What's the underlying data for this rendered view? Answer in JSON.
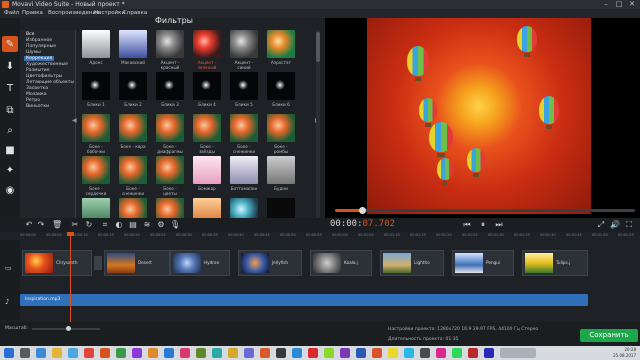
{
  "window": {
    "title": "Movavi Video Suite - Новый проект *",
    "min": "–",
    "max": "□",
    "close": "✕"
  },
  "menu": [
    "Файл",
    "Правка",
    "Воспроизведение",
    "Настройки",
    "Справка"
  ],
  "panel_title": "Фильтры",
  "categories": [
    "Все",
    "Избранное",
    "Популярные",
    "Шумы",
    "Коррекция",
    "Художественные",
    "Размытие",
    "Цветофильтры",
    "Летающие объекты",
    "Засветка",
    "Мозаика",
    "Ретро",
    "Виньетки"
  ],
  "filters_row1": [
    "Адонс",
    "Маковский",
    "Акцент - красный",
    "Акцент - зеленый",
    "Акцент - синий",
    "Аэростат"
  ],
  "filters_row2": [
    "Блики 1",
    "Блики 2",
    "Блики 3",
    "Блики 4",
    "Блики 5",
    "Блики 6"
  ],
  "filters_row3": [
    "Боке - бабочки",
    "Боке - кора",
    "Боке - диафрагмы",
    "Боке - звёзды",
    "Боке - снежинки",
    "Боке - ромбы"
  ],
  "filters_row4": [
    "Боке - сердечки",
    "Боке - снежинки",
    "Боке - цветы",
    "Бомжар",
    "Боттомапин",
    "Будни"
  ],
  "timecode": {
    "main": "00:00:",
    "ms": "07.702"
  },
  "ruler": [
    "00:00:00",
    "00:00:05",
    "00:00:10",
    "00:00:15",
    "00:00:20",
    "00:00:25",
    "00:00:30",
    "00:00:35",
    "00:00:40",
    "00:00:45",
    "00:00:50",
    "00:00:55",
    "00:01:00",
    "00:01:05",
    "00:01:10",
    "00:01:15",
    "00:01:20",
    "00:01:25",
    "00:01:30",
    "00:01:35",
    "00:01:40",
    "00:01:45",
    "00:01:50",
    "00:01:55"
  ],
  "clips": [
    "Chrysanth",
    "Desert",
    "Hydran",
    "Jellyfish",
    "Koala.j",
    "Lightho",
    "Pengui",
    "Tulips.j"
  ],
  "audio": {
    "name": "Inspiration.mp3"
  },
  "bottom": {
    "scale_label": "Масштаб:",
    "project_settings": "Настройки проекта:  1280x720 16:9 29.97 FPS, 44100 Гц Стерео",
    "duration": "Длительность проекта:  01:35",
    "save_label": "Сохранить"
  },
  "tray": {
    "time": "20:28",
    "date": "25.08.2017"
  },
  "colors": {
    "accent": "#d4541c",
    "save": "#1ea64a",
    "audio": "#2f70b8"
  }
}
